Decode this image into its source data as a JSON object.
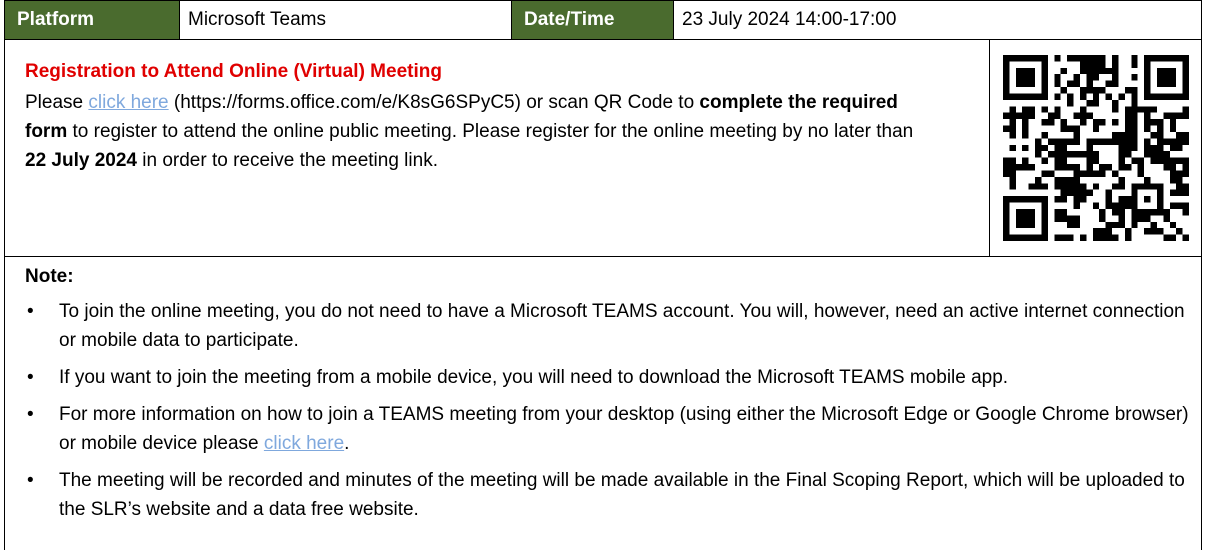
{
  "header": {
    "platform_label": "Platform",
    "platform_value": "Microsoft Teams",
    "datetime_label": "Date/Time",
    "datetime_value": "23 July 2024 14:00-17:00"
  },
  "registration": {
    "title": "Registration to Attend Online (Virtual) Meeting",
    "text_1": "Please ",
    "link_1": "click here",
    "text_2": " (https://forms.office.com/e/K8sG6SPyC5) or scan QR Code to ",
    "bold_1": "complete the required form",
    "text_3": " to register to attend the online public meeting. Please register for the online meeting by no later than ",
    "bold_2": "22 July 2024",
    "text_4": " in order to receive the meeting link."
  },
  "note": {
    "title": "Note:",
    "items": [
      "To join the online meeting, you do not need to have a Microsoft TEAMS account. You will, however, need an active internet connection or mobile data to participate.",
      "If you want to join the meeting from a mobile device, you will need to download the Microsoft TEAMS mobile app.",
      "The meeting will be recorded and minutes of the meeting will be made available in the Final Scoping Report, which will be uploaded to the SLR’s website and a data free website."
    ],
    "item_3_text": "For more information on how to join a TEAMS meeting from your desktop (using either the Microsoft Edge or Google Chrome browser) or mobile device please ",
    "item_3_link": "click here",
    "item_3_end": "."
  },
  "colors": {
    "header_label_bg": "#4a6b2e",
    "title_red": "#e00000",
    "link_blue": "#7fa8dd"
  },
  "icons": {
    "qr": "qr-code-icon"
  }
}
